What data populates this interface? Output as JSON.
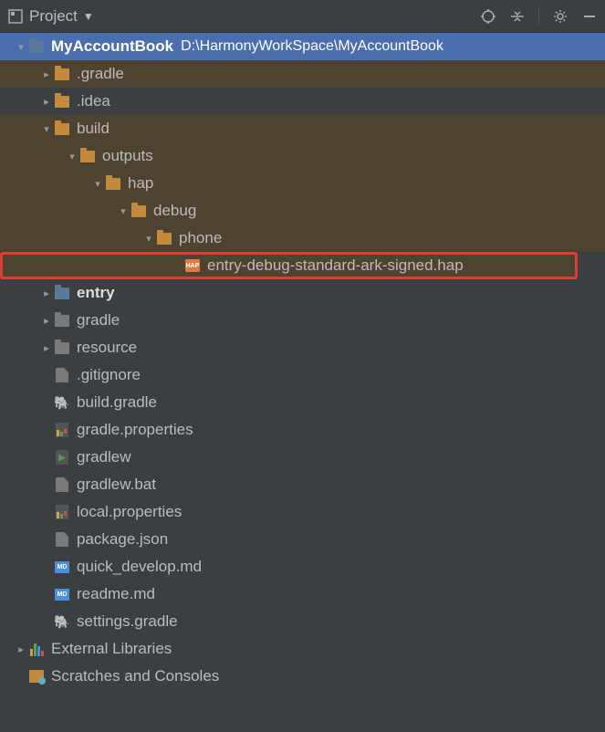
{
  "toolbar": {
    "title": "Project"
  },
  "root": {
    "name": "MyAccountBook",
    "path": "D:\\HarmonyWorkSpace\\MyAccountBook"
  },
  "folders": {
    "gradle_dot": ".gradle",
    "idea_dot": ".idea",
    "build": "build",
    "outputs": "outputs",
    "hap": "hap",
    "debug": "debug",
    "phone": "phone",
    "entry": "entry",
    "gradle": "gradle",
    "resource": "resource"
  },
  "highlighted_file": "entry-debug-standard-ark-signed.hap",
  "files": {
    "gitignore": ".gitignore",
    "build_gradle": "build.gradle",
    "gradle_props": "gradle.properties",
    "gradlew": "gradlew",
    "gradlew_bat": "gradlew.bat",
    "local_props": "local.properties",
    "package_json": "package.json",
    "quick_dev": "quick_develop.md",
    "readme": "readme.md",
    "settings_gradle": "settings.gradle"
  },
  "bottom": {
    "ext_libs": "External Libraries",
    "scratches": "Scratches and Consoles"
  }
}
